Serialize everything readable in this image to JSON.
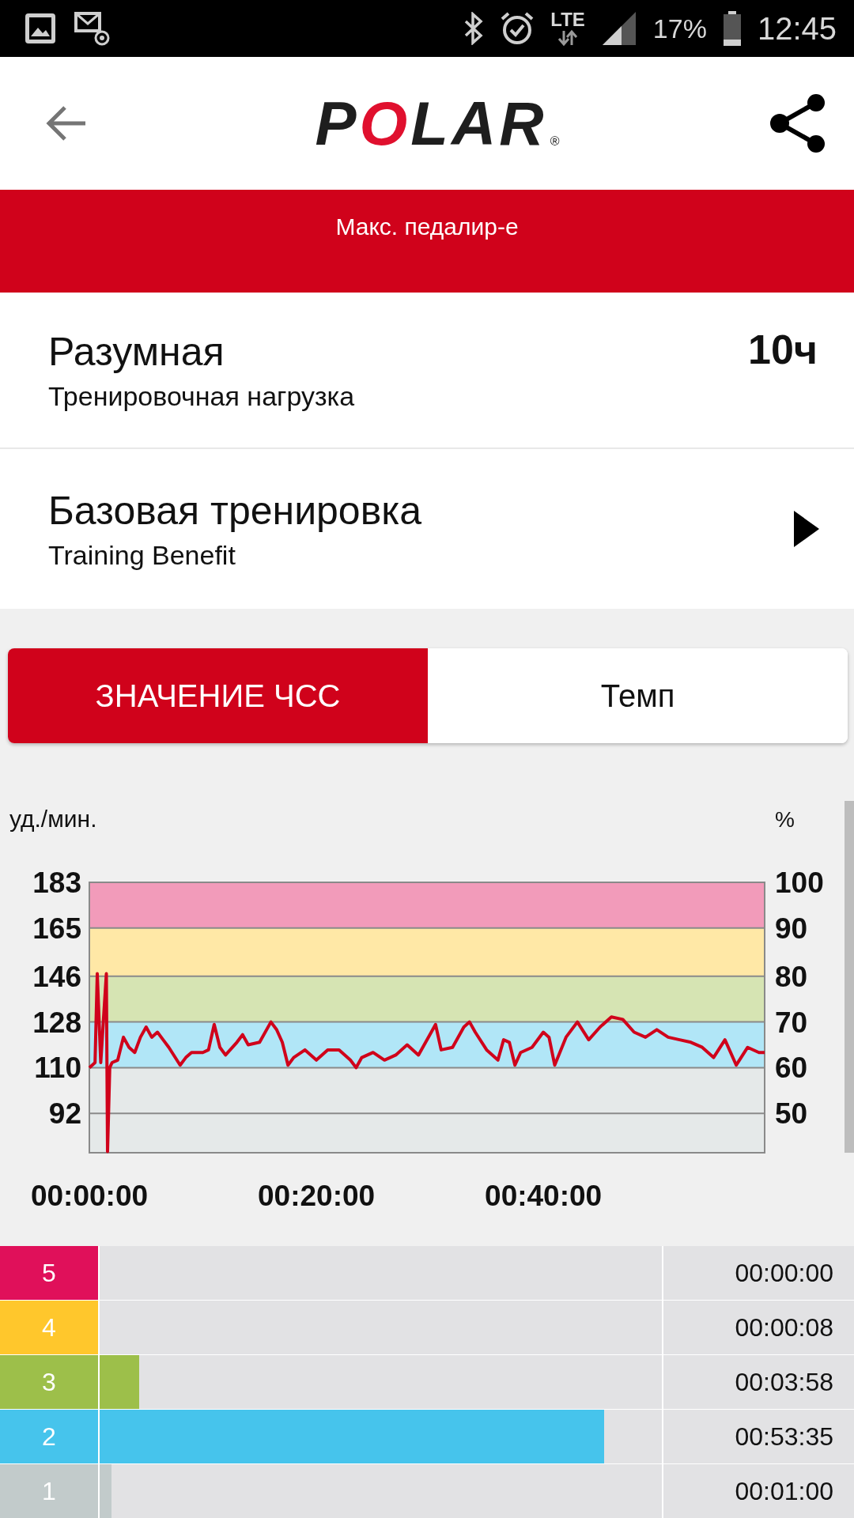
{
  "status_bar": {
    "network": "LTE",
    "battery": "17%",
    "time": "12:45"
  },
  "header": {
    "logo": "POLAR",
    "logo_mark": "®"
  },
  "banner": {
    "label": "Макс. педалир-е"
  },
  "summary_rows": [
    {
      "kind": "value",
      "title": "Разумная",
      "subtitle": "Тренировочная нагрузка",
      "value": "10ч"
    },
    {
      "kind": "link",
      "title": "Базовая тренировка",
      "subtitle": "Training Benefit"
    }
  ],
  "toggle": [
    {
      "label": "ЗНАЧЕНИЕ ЧСС",
      "selected": true
    },
    {
      "label": "Темп",
      "selected": false
    }
  ],
  "chart": {
    "right_axis": {
      "label": "%",
      "ticks": [
        "100",
        "90",
        "80",
        "70",
        "60",
        "50"
      ]
    },
    "chart_data": {
      "type": "line",
      "ylabel": "уд./мин.",
      "xlim": [
        0,
        59.5
      ],
      "ylim": [
        76.5,
        183
      ],
      "xticks": [
        {
          "value": 0,
          "label": "00:00:00"
        },
        {
          "value": 20,
          "label": "00:20:00"
        },
        {
          "value": 40,
          "label": "00:40:00"
        }
      ],
      "yticks": [
        183,
        165,
        146,
        128,
        110,
        92
      ],
      "x": [
        0,
        0.5,
        0.7,
        1.0,
        1.5,
        1.6,
        1.8,
        2,
        2.5,
        3,
        3.5,
        4,
        4.5,
        5,
        5.5,
        6,
        6.5,
        7,
        8,
        8.5,
        9,
        10,
        10.5,
        11,
        11.5,
        12,
        13,
        13.5,
        14,
        15,
        16,
        16.5,
        17,
        17.5,
        18,
        19,
        20,
        21,
        22,
        23,
        23.5,
        24,
        25,
        26,
        27,
        28,
        29,
        30,
        30.5,
        31,
        32,
        33,
        33.5,
        34,
        35,
        36,
        36.5,
        37,
        37.5,
        38,
        39,
        40,
        40.5,
        41,
        42,
        43,
        44,
        45,
        46,
        47,
        48,
        49,
        50,
        51,
        52,
        53,
        54,
        55,
        56,
        57,
        58,
        59,
        59.5
      ],
      "series": [
        {
          "color": "#d0021b",
          "values": [
            110,
            112,
            147,
            112,
            147,
            77,
            110,
            112,
            113,
            122,
            118,
            116,
            122,
            126,
            122,
            124,
            121,
            118,
            111,
            114,
            116,
            116,
            117,
            127,
            118,
            115,
            120,
            123,
            119,
            120,
            128,
            125,
            120,
            111,
            114,
            117,
            113,
            117,
            117,
            113,
            110,
            114,
            116,
            113,
            115,
            119,
            115,
            123,
            127,
            117,
            118,
            126,
            128,
            124,
            117,
            113,
            121,
            120,
            111,
            116,
            118,
            124,
            122,
            111,
            122,
            128,
            121,
            126,
            130,
            129,
            124,
            122,
            125,
            122,
            121,
            120,
            118,
            114,
            121,
            111,
            118,
            116,
            116
          ]
        }
      ],
      "grid": true
    }
  },
  "zones": [
    {
      "label": "5",
      "color": "#e0105a",
      "level": 0,
      "time": "00:00:00"
    },
    {
      "label": "4",
      "color": "#ffc72c",
      "level": 0,
      "time": "00:00:08"
    },
    {
      "label": "3",
      "color": "#9dbf4a",
      "level": 0.07,
      "time": "00:03:58"
    },
    {
      "label": "2",
      "color": "#46c4ec",
      "level": 0.897,
      "time": "00:53:35"
    },
    {
      "label": "1",
      "color": "#c2cbcb",
      "level": 0.021,
      "time": "00:01:00"
    }
  ]
}
